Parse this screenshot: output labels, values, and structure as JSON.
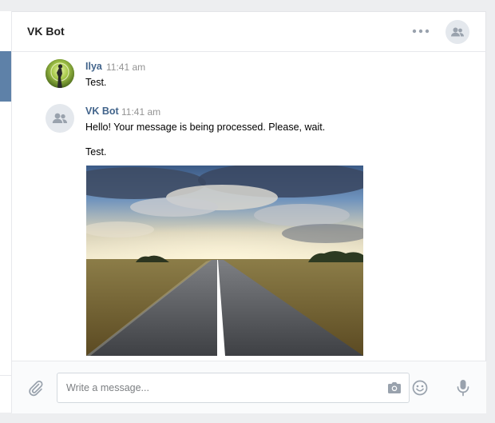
{
  "header": {
    "title": "VK Bot",
    "more_icon": "more-dots-icon",
    "chat_avatar_icon": "group-users-icon"
  },
  "messages": [
    {
      "author": "Ilya",
      "time": "11:41 am",
      "lines": [
        "Test."
      ],
      "avatar": "user-photo"
    },
    {
      "author": "VK Bot",
      "time": "11:41 am",
      "lines": [
        "Hello! Your message is being processed. Please, wait.",
        "Test."
      ],
      "avatar": "group-users-icon",
      "attachment": "road-landscape-photo"
    }
  ],
  "composer": {
    "placeholder": "Write a message...",
    "attach_icon": "paperclip-icon",
    "camera_icon": "camera-icon",
    "emoji_icon": "smile-icon",
    "mic_icon": "microphone-icon"
  },
  "colors": {
    "accent": "#42648b",
    "selected_dialog": "#5e81a8",
    "icon": "#99a2ad",
    "background": "#edeef0"
  }
}
